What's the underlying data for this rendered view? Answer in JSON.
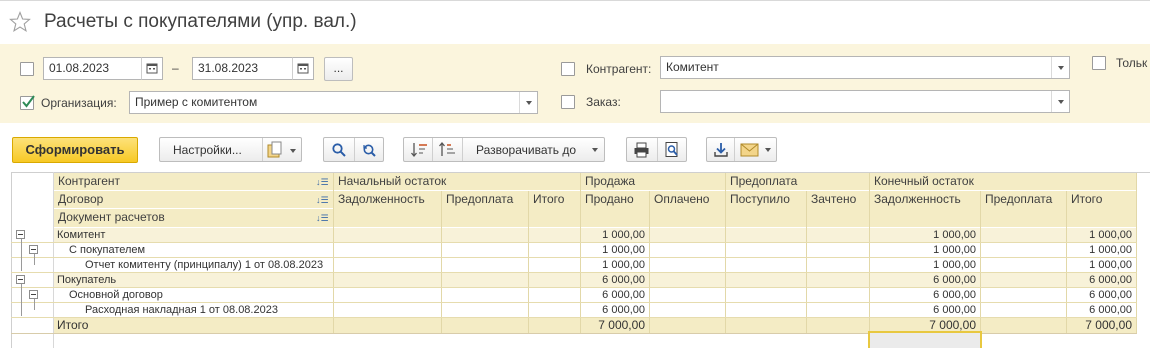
{
  "window": {
    "title": "Расчеты с покупателями (упр. вал.)"
  },
  "filters": {
    "date_from": "01.08.2023",
    "date_sep": "–",
    "date_to": "31.08.2023",
    "period_button": "...",
    "organization_label": "Организация:",
    "organization_value": "Пример с комитентом",
    "counterparty_label": "Контрагент:",
    "counterparty_value": "Комитент",
    "order_label": "Заказ:",
    "order_value": "",
    "only_label": "Тольк"
  },
  "toolbar": {
    "generate": "Сформировать",
    "settings": "Настройки...",
    "expand_to": "Разворачивать до"
  },
  "table": {
    "group_headers": [
      "Контрагент",
      "Договор",
      "Документ расчетов"
    ],
    "column_groups": [
      "Начальный остаток",
      "Продажа",
      "Предоплата",
      "Конечный остаток"
    ],
    "columns": [
      "Задолженность",
      "Предоплата",
      "Итого",
      "Продано",
      "Оплачено",
      "Поступило",
      "Зачтено",
      "Задолженность",
      "Предоплата",
      "Итого"
    ],
    "rows": [
      {
        "label": "Комитент",
        "values": [
          "",
          "",
          "",
          "1 000,00",
          "",
          "",
          "",
          "1 000,00",
          "",
          "1 000,00"
        ]
      },
      {
        "label": "С покупателем",
        "values": [
          "",
          "",
          "",
          "1 000,00",
          "",
          "",
          "",
          "1 000,00",
          "",
          "1 000,00"
        ]
      },
      {
        "label": "Отчет комитенту (принципалу) 1 от 08.08.2023",
        "values": [
          "",
          "",
          "",
          "1 000,00",
          "",
          "",
          "",
          "1 000,00",
          "",
          "1 000,00"
        ]
      },
      {
        "label": "Покупатель",
        "values": [
          "",
          "",
          "",
          "6 000,00",
          "",
          "",
          "",
          "6 000,00",
          "",
          "6 000,00"
        ]
      },
      {
        "label": "Основной договор",
        "values": [
          "",
          "",
          "",
          "6 000,00",
          "",
          "",
          "",
          "6 000,00",
          "",
          "6 000,00"
        ]
      },
      {
        "label": "Расходная накладная 1 от 08.08.2023",
        "values": [
          "",
          "",
          "",
          "6 000,00",
          "",
          "",
          "",
          "6 000,00",
          "",
          "6 000,00"
        ]
      }
    ],
    "total": {
      "label": "Итого",
      "values": [
        "",
        "",
        "",
        "7 000,00",
        "",
        "",
        "",
        "7 000,00",
        "",
        "7 000,00"
      ]
    }
  },
  "colors": {
    "accent": "#f7c925",
    "header_bg": "#f4ecc5",
    "filter_bg": "#fbf5dd"
  }
}
